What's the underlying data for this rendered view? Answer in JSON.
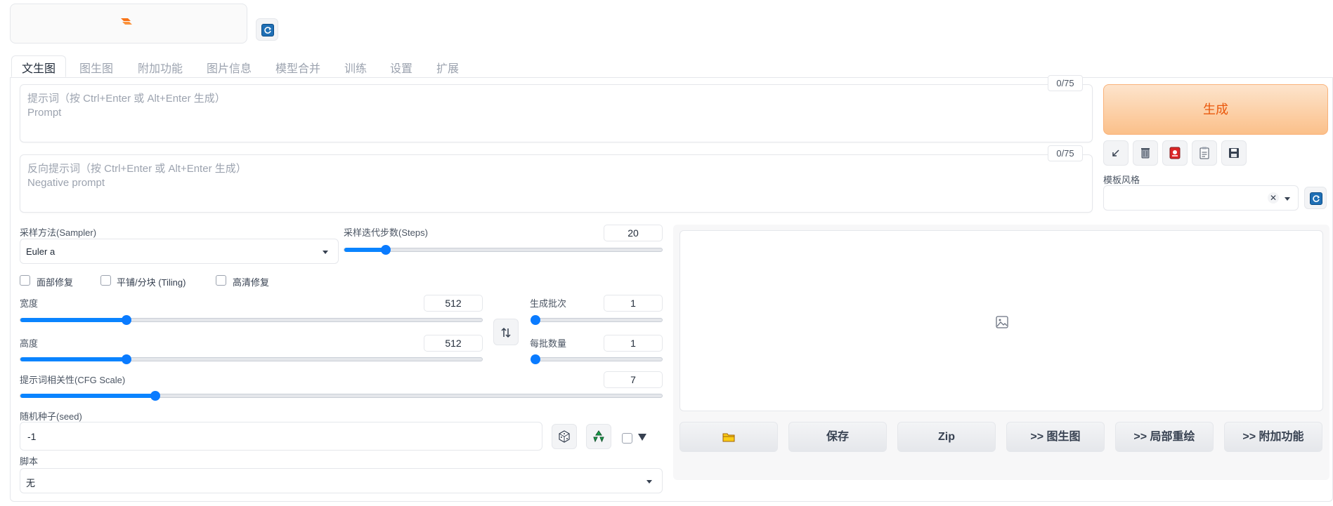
{
  "header": {
    "model_value": ""
  },
  "tabs": [
    {
      "label": "文生图",
      "active": true
    },
    {
      "label": "图生图"
    },
    {
      "label": "附加功能"
    },
    {
      "label": "图片信息"
    },
    {
      "label": "模型合并"
    },
    {
      "label": "训练"
    },
    {
      "label": "设置"
    },
    {
      "label": "扩展"
    }
  ],
  "prompt": {
    "placeholder": "提示词（按 Ctrl+Enter 或 Alt+Enter 生成）\nPrompt",
    "token_count": "0/75"
  },
  "negative_prompt": {
    "placeholder": "反向提示词（按 Ctrl+Enter 或 Alt+Enter 生成）\nNegative prompt",
    "token_count": "0/75"
  },
  "generate": {
    "label": "生成"
  },
  "toolbar_icons": [
    "arrow-icon",
    "trash-icon",
    "red-card-icon",
    "clipboard-icon",
    "save-disk-icon"
  ],
  "styles": {
    "label": "模板风格",
    "value": ""
  },
  "sampler": {
    "label": "采样方法(Sampler)",
    "value": "Euler a"
  },
  "steps": {
    "label": "采样迭代步数(Steps)",
    "value": "20",
    "fraction": 0.13
  },
  "checkboxes": [
    {
      "label": "面部修复",
      "checked": false
    },
    {
      "label": "平铺/分块 (Tiling)",
      "checked": false
    },
    {
      "label": "高清修复",
      "checked": false
    }
  ],
  "width": {
    "label": "宽度",
    "value": "512",
    "fraction": 0.23
  },
  "height": {
    "label": "高度",
    "value": "512",
    "fraction": 0.23
  },
  "batch_count": {
    "label": "生成批次",
    "value": "1",
    "fraction": 0.0
  },
  "batch_size": {
    "label": "每批数量",
    "value": "1",
    "fraction": 0.0
  },
  "cfg": {
    "label": "提示词相关性(CFG Scale)",
    "value": "7",
    "fraction": 0.21
  },
  "seed": {
    "label": "随机种子(seed)",
    "value": "-1"
  },
  "script": {
    "label": "脚本",
    "value": "无"
  },
  "actions": [
    {
      "label": "",
      "icon": "folder-icon"
    },
    {
      "label": "保存"
    },
    {
      "label": "Zip"
    },
    {
      "label": ">> 图生图"
    },
    {
      "label": ">> 局部重绘"
    },
    {
      "label": ">> 附加功能"
    }
  ],
  "colors": {
    "accent": "#0a7bff",
    "generate_text": "#ea580c"
  }
}
